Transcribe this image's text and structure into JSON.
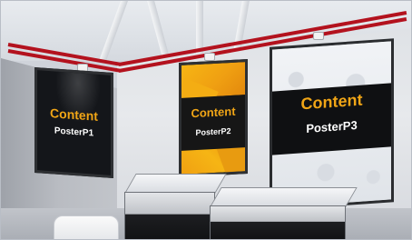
{
  "scene": {
    "posters": [
      {
        "heading": "Content",
        "caption": "PosterP1"
      },
      {
        "heading": "Content",
        "caption": "PosterP2"
      },
      {
        "heading": "Content",
        "caption": "PosterP3"
      }
    ]
  },
  "colors": {
    "stripe": "#b3121e",
    "heading_text": "#f0a516",
    "caption_text": "#ffffff",
    "poster_yellow": "#f6b514"
  }
}
